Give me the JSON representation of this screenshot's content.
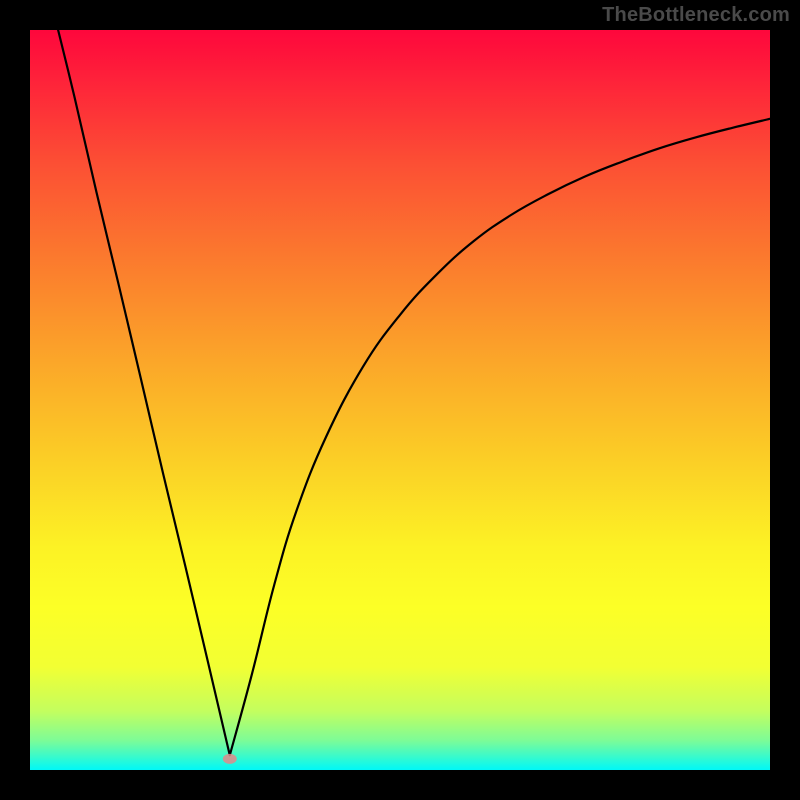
{
  "watermark": "TheBottleneck.com",
  "chart_data": {
    "type": "line",
    "title": "",
    "xlabel": "",
    "ylabel": "",
    "xlim": [
      0,
      100
    ],
    "ylim": [
      0,
      100
    ],
    "notes": "Background is a vertical gradient from red (top) through orange/yellow to green (bottom), indicating bottleneck percentage. Black curve is a V/funnel shape with minimum near x≈27 reaching y≈0, left branch descending steeply from top-left corner, right branch rising with decreasing slope to about y≈88 at x=100. A small pink marker sits at the curve minimum.",
    "series": [
      {
        "name": "bottleneck-curve",
        "x": [
          3.8,
          6,
          9,
          12,
          15,
          18,
          21,
          24,
          27,
          30,
          33,
          36,
          40,
          45,
          50,
          55,
          60,
          65,
          70,
          75,
          80,
          85,
          90,
          95,
          100
        ],
        "y": [
          100,
          91,
          78,
          65.5,
          52.8,
          40,
          27.5,
          14.8,
          2,
          13,
          25,
          35,
          45,
          54.5,
          61.5,
          67,
          71.5,
          75,
          77.8,
          80.2,
          82.2,
          84,
          85.5,
          86.8,
          88
        ]
      }
    ],
    "marker": {
      "x": 27,
      "y": 1.5
    },
    "gradient_stops": [
      {
        "offset": 0.0,
        "color": "#fe073c"
      },
      {
        "offset": 0.06,
        "color": "#fe1f3a"
      },
      {
        "offset": 0.18,
        "color": "#fc4f34"
      },
      {
        "offset": 0.3,
        "color": "#fb772e"
      },
      {
        "offset": 0.45,
        "color": "#fba729"
      },
      {
        "offset": 0.58,
        "color": "#fbce26"
      },
      {
        "offset": 0.7,
        "color": "#fcf225"
      },
      {
        "offset": 0.78,
        "color": "#fcff26"
      },
      {
        "offset": 0.86,
        "color": "#f2ff33"
      },
      {
        "offset": 0.92,
        "color": "#c4fe5e"
      },
      {
        "offset": 0.96,
        "color": "#7dfc97"
      },
      {
        "offset": 1.0,
        "color": "#00f8f8"
      }
    ]
  }
}
